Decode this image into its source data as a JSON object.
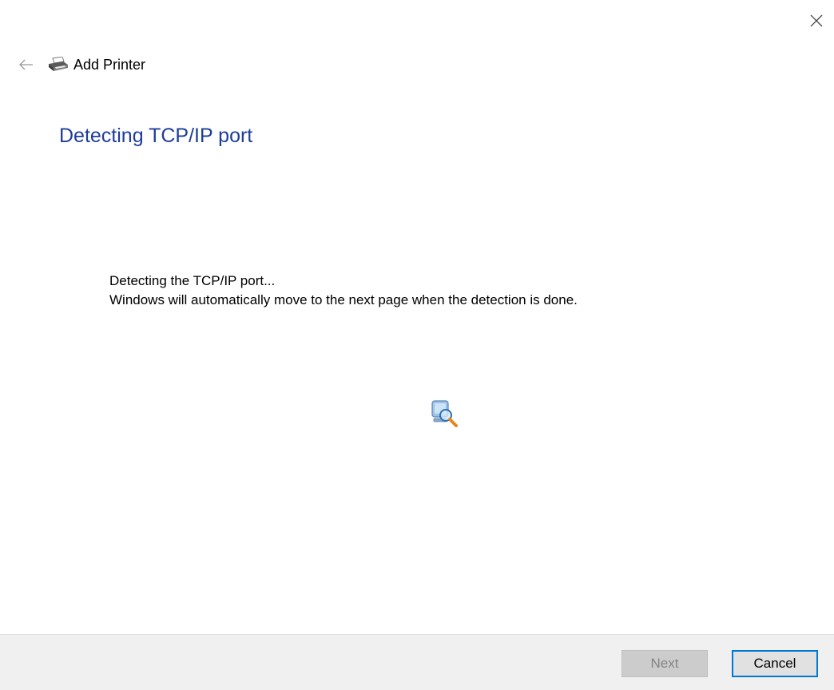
{
  "window": {
    "title": "Add Printer"
  },
  "header": {
    "back_icon": "arrow-left-icon",
    "printer_icon": "printer-icon",
    "close_icon": "close-icon"
  },
  "main": {
    "heading": "Detecting TCP/IP port",
    "status_line": "Detecting the TCP/IP port...",
    "info_line": "Windows will automatically move to the next page when the detection is done.",
    "animation_icon": "search-monitor-icon"
  },
  "footer": {
    "next_label": "Next",
    "next_enabled": false,
    "cancel_label": "Cancel"
  },
  "colors": {
    "heading": "#1e3d9a",
    "footer_bg": "#f0f0f0",
    "focus_border": "#0078d7"
  }
}
